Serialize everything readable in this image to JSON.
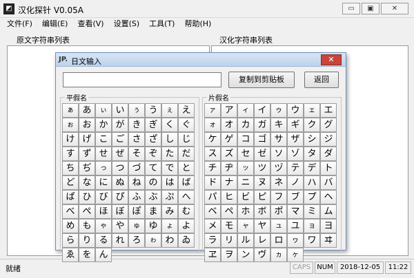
{
  "app": {
    "title": "汉化探针  V0.05A",
    "icon": "app-logo-icon"
  },
  "window_buttons": {
    "minimize": "▭",
    "maximize": "▣",
    "close": "✕"
  },
  "menu": [
    "文件(F)",
    "编辑(E)",
    "查看(V)",
    "设置(S)",
    "工具(T)",
    "帮助(H)"
  ],
  "panels": {
    "left_title": "原文字符串列表",
    "right_title": "汉化字符串列表"
  },
  "dialog": {
    "icon_text": "JP.",
    "title": "日文输入",
    "input_value": "",
    "copy_button": "复制到剪贴板",
    "back_button": "返回",
    "close": "✕",
    "hiragana_label": "平假名",
    "katakana_label": "片假名",
    "hiragana": [
      "ぁ",
      "あ",
      "ぃ",
      "い",
      "ぅ",
      "う",
      "ぇ",
      "え",
      "ぉ",
      "お",
      "か",
      "が",
      "き",
      "ぎ",
      "く",
      "ぐ",
      "け",
      "げ",
      "こ",
      "ご",
      "さ",
      "ざ",
      "し",
      "じ",
      "す",
      "ず",
      "せ",
      "ぜ",
      "そ",
      "ぞ",
      "た",
      "だ",
      "ち",
      "ぢ",
      "っ",
      "つ",
      "づ",
      "て",
      "で",
      "と",
      "ど",
      "な",
      "に",
      "ぬ",
      "ね",
      "の",
      "は",
      "ば",
      "ぱ",
      "ひ",
      "び",
      "ぴ",
      "ふ",
      "ぶ",
      "ぷ",
      "へ",
      "べ",
      "ぺ",
      "ほ",
      "ぼ",
      "ぽ",
      "ま",
      "み",
      "む",
      "め",
      "も",
      "ゃ",
      "や",
      "ゅ",
      "ゆ",
      "ょ",
      "よ",
      "ら",
      "り",
      "る",
      "れ",
      "ろ",
      "ゎ",
      "わ",
      "ゐ",
      "ゑ",
      "を",
      "ん"
    ],
    "katakana": [
      "ァ",
      "ア",
      "ィ",
      "イ",
      "ゥ",
      "ウ",
      "ェ",
      "エ",
      "ォ",
      "オ",
      "カ",
      "ガ",
      "キ",
      "ギ",
      "ク",
      "グ",
      "ケ",
      "ゲ",
      "コ",
      "ゴ",
      "サ",
      "ザ",
      "シ",
      "ジ",
      "ス",
      "ズ",
      "セ",
      "ゼ",
      "ソ",
      "ゾ",
      "タ",
      "ダ",
      "チ",
      "ヂ",
      "ッ",
      "ツ",
      "ヅ",
      "テ",
      "デ",
      "ト",
      "ド",
      "ナ",
      "ニ",
      "ヌ",
      "ネ",
      "ノ",
      "ハ",
      "バ",
      "パ",
      "ヒ",
      "ビ",
      "ピ",
      "フ",
      "ブ",
      "プ",
      "ヘ",
      "ベ",
      "ペ",
      "ホ",
      "ボ",
      "ポ",
      "マ",
      "ミ",
      "ム",
      "メ",
      "モ",
      "ャ",
      "ヤ",
      "ュ",
      "ユ",
      "ョ",
      "ヨ",
      "ラ",
      "リ",
      "ル",
      "レ",
      "ロ",
      "ヮ",
      "ワ",
      "ヰ",
      "ヱ",
      "ヲ",
      "ン",
      "ヴ",
      "ヵ",
      "ヶ"
    ]
  },
  "status": {
    "text": "就绪",
    "caps": "CAPS",
    "num": "NUM",
    "date": "2018-12-05",
    "time": "11:22"
  }
}
